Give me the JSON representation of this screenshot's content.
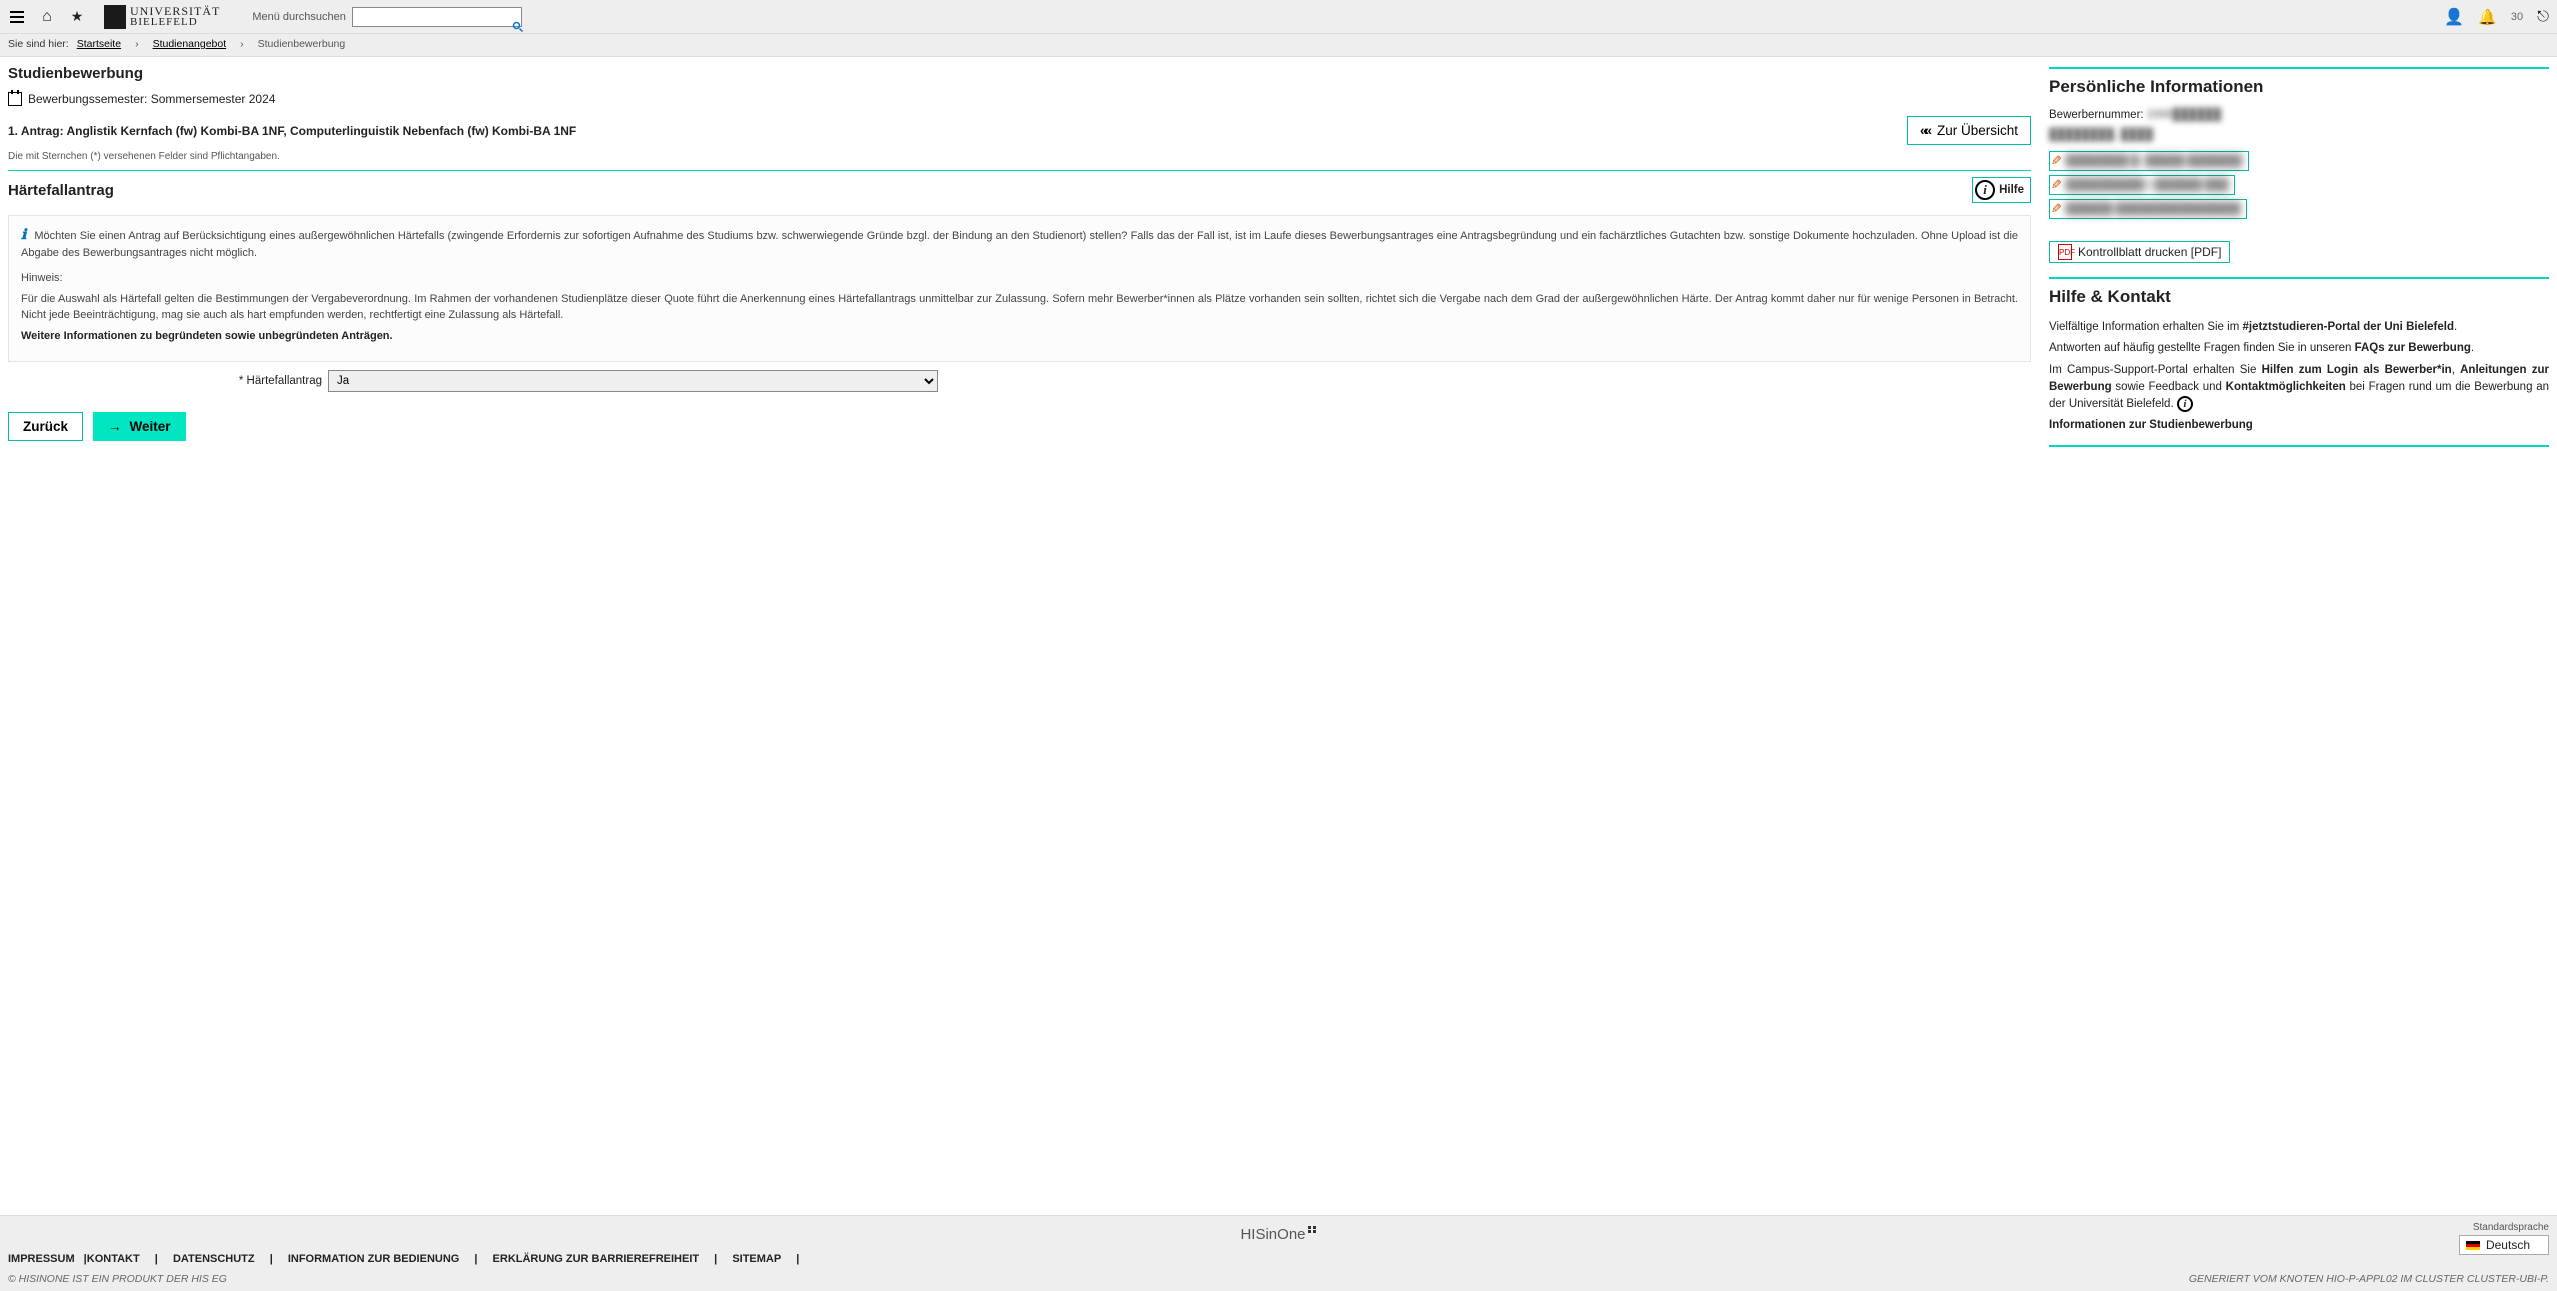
{
  "header": {
    "search_label": "Menü durchsuchen",
    "notif_count": "30"
  },
  "logo": {
    "line1": "UNIVERSITÄT",
    "line2": "BIELEFELD"
  },
  "breadcrumb": {
    "label": "Sie sind hier:",
    "items": [
      "Startseite",
      "Studienangebot",
      "Studienbewerbung"
    ]
  },
  "page": {
    "title": "Studienbewerbung",
    "semester_line": "Bewerbungssemester: Sommersemester 2024",
    "antrag_title": "1. Antrag: Anglistik Kernfach (fw) Kombi-BA 1NF, Computerlinguistik Nebenfach (fw) Kombi-BA 1NF",
    "overview_btn": "Zur Übersicht",
    "mandatory_note": "Die mit Sternchen (*) versehenen Felder sind Pflichtangaben.",
    "section_title": "Härtefallantrag",
    "hilfe_label": "Hilfe"
  },
  "hint": {
    "p1": "Möchten Sie einen Antrag auf Berücksichtigung eines außergewöhnlichen Härtefalls (zwingende Erfordernis zur sofortigen Aufnahme des Studiums bzw. schwerwiegende Gründe bzgl. der Bindung an den Studienort) stellen? Falls das der Fall ist, ist im Laufe dieses Bewerbungsantrages eine Antragsbegründung und ein fachärztliches Gutachten bzw. sonstige Dokumente hochzuladen. Ohne Upload ist die Abgabe des Bewerbungsantrages nicht möglich.",
    "p2_label": "Hinweis:",
    "p2": "Für die Auswahl als Härtefall gelten die Bestimmungen der Vergabeverordnung. Im Rahmen der vorhandenen Studienplätze dieser Quote führt die Anerkennung eines Härtefallantrags unmittelbar zur Zulassung. Sofern mehr Bewerber*innen als Plätze vorhanden sein sollten, richtet sich die Vergabe nach dem Grad der außergewöhnlichen Härte. Der Antrag kommt daher nur für wenige Personen in Betracht. Nicht jede Beeinträchtigung, mag sie auch als hart empfunden werden, rechtfertigt eine Zulassung als Härtefall.",
    "p3_bold": "Weitere Informationen zu begründeten sowie unbegründeten Anträgen."
  },
  "field": {
    "label": "* Härtefallantrag",
    "value": "Ja"
  },
  "nav": {
    "back": "Zurück",
    "next": "Weiter"
  },
  "personal": {
    "title": "Persönliche Informationen",
    "num_label": "Bewerbernummer: ",
    "num_value": "1000██████",
    "name": "████████, ████",
    "edit1": "████████ █, █████ ███████",
    "edit2": "██████████@██████.███",
    "edit3": "██████ ████████████████",
    "pdf": "Kontrollblatt drucken [PDF]"
  },
  "help": {
    "title": "Hilfe & Kontakt",
    "l1a": "Vielfältige Information erhalten Sie im ",
    "l1b": "#jetztstudieren-Portal der Uni Bielefeld",
    "l1c": ".",
    "l2a": "Antworten auf häufig gestellte Fragen finden Sie in unseren ",
    "l2b": "FAQs zur Bewerbung",
    "l2c": ".",
    "l3a": "Im Campus-Support-Portal erhalten Sie ",
    "l3b": "Hilfen zum Login als Bewerber*in",
    "l3c": ", ",
    "l3d": "Anleitungen zur Bewerbung",
    "l3e": " sowie Feedback und ",
    "l3f": "Kontaktmöglichkeiten",
    "l3g": " bei Fragen rund um die Bewerbung an der Universität Bielefeld. ",
    "l4": "Informationen zur Studienbewerbung"
  },
  "footer": {
    "brand": "HISinOne",
    "lang_label": "Standardsprache",
    "lang_value": "Deutsch",
    "links": [
      "IMPRESSUM",
      "KONTAKT",
      "DATENSCHUTZ",
      "INFORMATION ZUR BEDIENUNG",
      "ERKLÄRUNG ZUR BARRIEREFREIHEIT",
      "SITEMAP"
    ],
    "left": "© HISINONE IST EIN PRODUKT DER HIS EG",
    "right": "GENERIERT VOM KNOTEN HIO-P-APPL02 IM CLUSTER CLUSTER-UBI-P."
  }
}
